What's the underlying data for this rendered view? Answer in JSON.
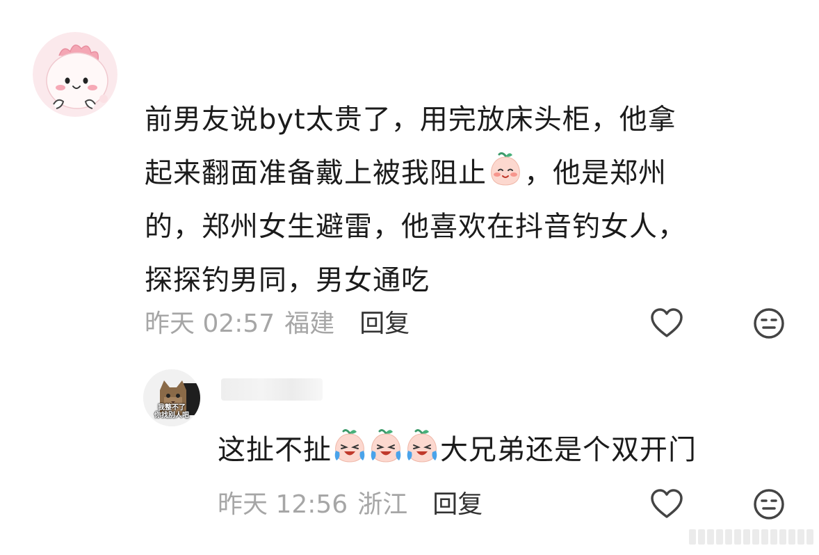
{
  "comments": [
    {
      "avatar_icon": "pink-cartoon-avatar-icon",
      "text_lines": [
        {
          "before": "前男友说byt太贵了，用完放床头柜，他拿",
          "emoji": "",
          "after": ""
        },
        {
          "before": "起来翻面准备戴上被我阻止",
          "emoji": "smiling-peach-emoji",
          "after": "，他是郑州"
        },
        {
          "before": "的，郑州女生避雷，他喜欢在抖音钓女人，",
          "emoji": "",
          "after": ""
        },
        {
          "before": "探探钓男同，男女通吃",
          "emoji": "",
          "after": ""
        }
      ],
      "time": "昨天 02:57",
      "location": "福建",
      "reply_label": "回复",
      "like_icon": "heart-outline-icon",
      "dislike_icon": "meh-face-icon"
    },
    {
      "avatar_icon": "cat-meme-avatar-icon",
      "avatar_text_top": "我整不了",
      "avatar_text_bottom": "你找别人吧",
      "text_before": "这扯不扯",
      "emoji": "crying-laughing-peach-emoji",
      "emoji_count": 3,
      "text_after": "大兄弟还是个双开门",
      "time": "昨天 12:56",
      "location": "浙江",
      "reply_label": "回复",
      "like_icon": "heart-outline-icon",
      "dislike_icon": "meh-face-icon"
    }
  ],
  "colors": {
    "text": "#1b1b1b",
    "meta": "#a6a6a6",
    "reply": "#333333",
    "icon": "#444444"
  }
}
